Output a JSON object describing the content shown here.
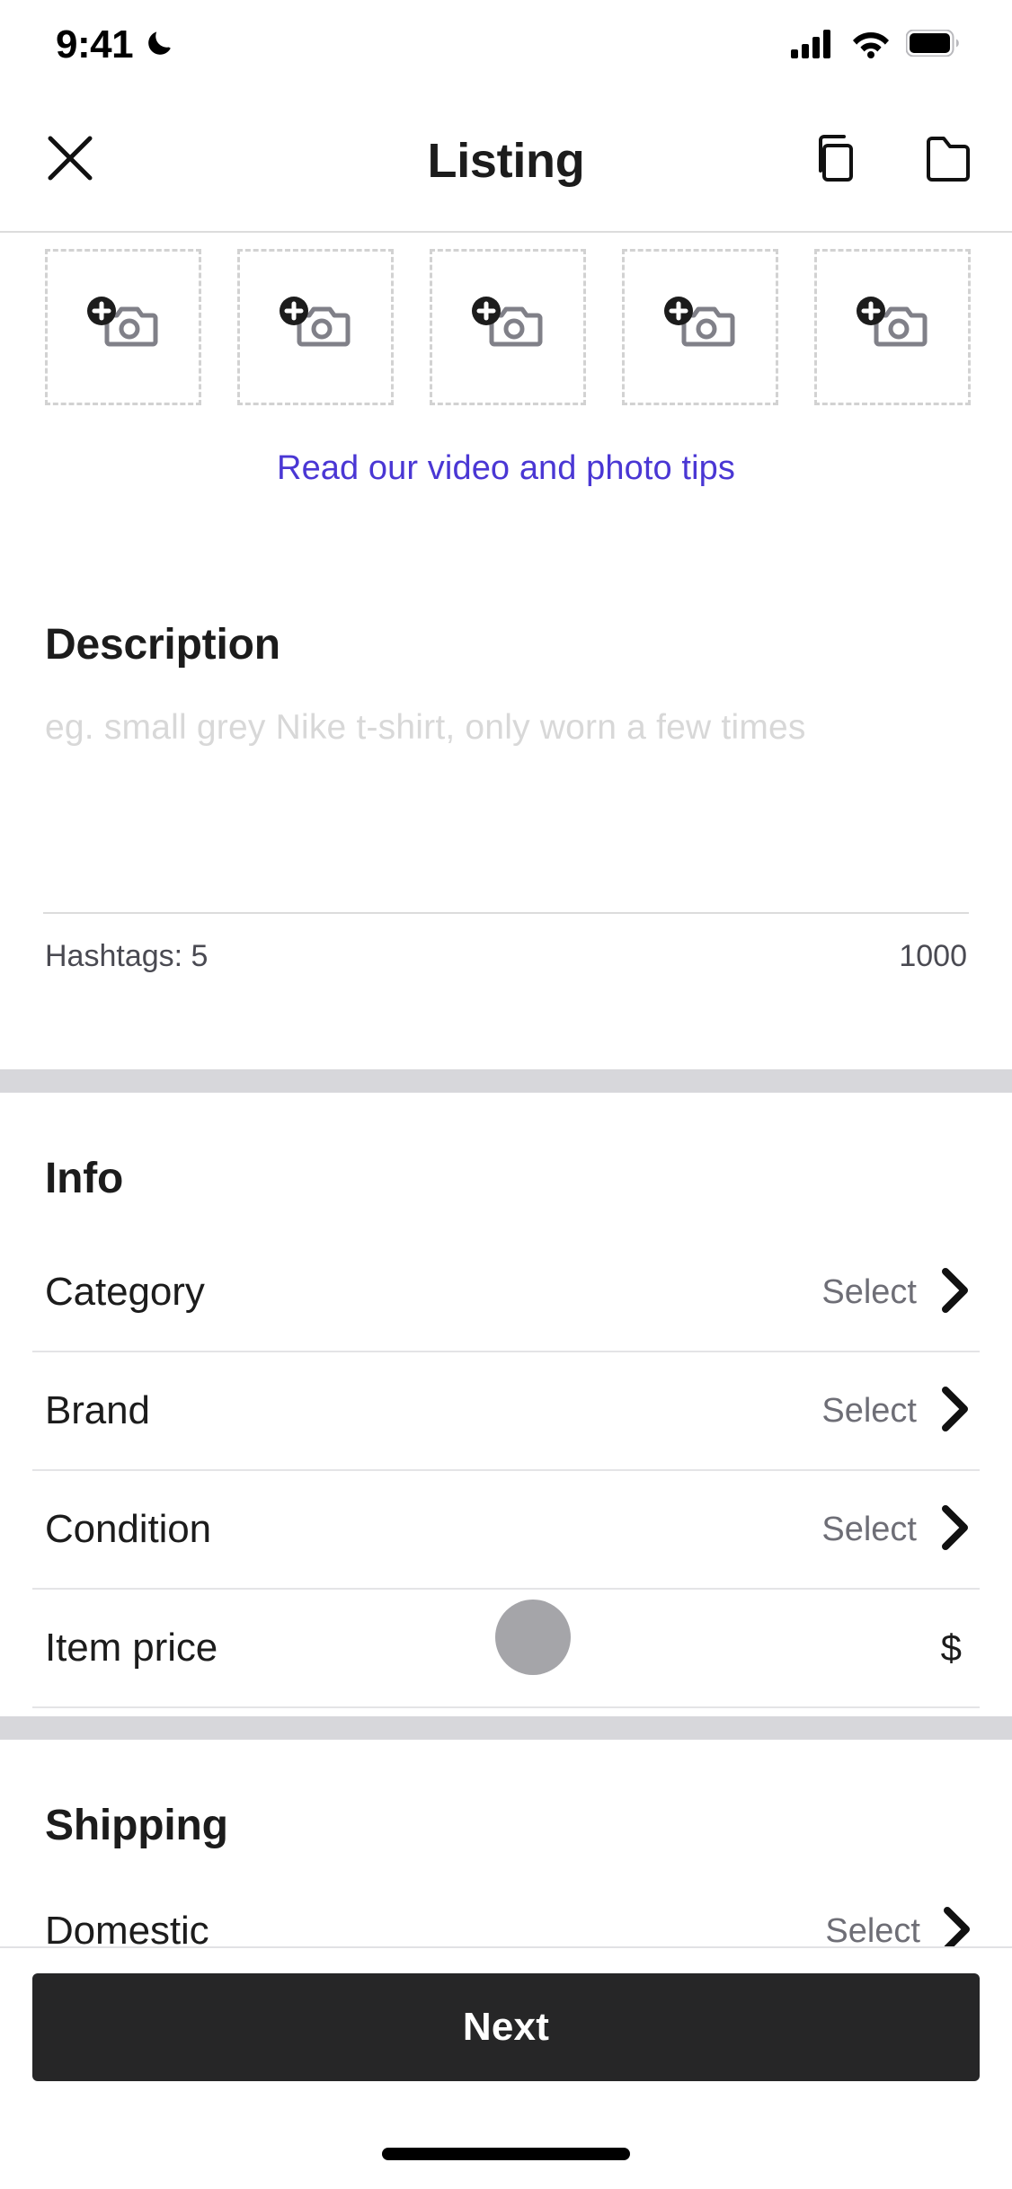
{
  "status_bar": {
    "time": "9:41",
    "dnd_icon": "crescent-moon-icon",
    "cellular_icon": "signal-bars-icon",
    "wifi_icon": "wifi-icon",
    "battery_icon": "battery-full-icon"
  },
  "header": {
    "close_icon": "close-x-icon",
    "title": "Listing",
    "copy_icon": "duplicate-copy-icon",
    "folder_icon": "folder-icon"
  },
  "photos": {
    "tile_icon": "add-photo-camera-icon",
    "tiles": [
      {
        "label": "Add photo 1"
      },
      {
        "label": "Add photo 2"
      },
      {
        "label": "Add photo 3"
      },
      {
        "label": "Add photo 4"
      },
      {
        "label": "Add photo 5"
      }
    ],
    "tips_link": "Read our video and photo tips",
    "tips_link_color": "#4a37d4"
  },
  "description": {
    "heading": "Description",
    "placeholder": "eg. small grey Nike t-shirt, only worn a few times",
    "value": "",
    "hashtags_label": "Hashtags: 5",
    "char_limit": "1000"
  },
  "info": {
    "heading": "Info",
    "rows": [
      {
        "label": "Category",
        "value": "Select",
        "accessory": "chevron-right-icon"
      },
      {
        "label": "Brand",
        "value": "Select",
        "accessory": "chevron-right-icon"
      },
      {
        "label": "Condition",
        "value": "Select",
        "accessory": "chevron-right-icon"
      },
      {
        "label": "Item price",
        "value": "$",
        "accessory": "currency-symbol"
      }
    ]
  },
  "shipping": {
    "heading": "Shipping",
    "rows": [
      {
        "label": "Domestic",
        "value": "Select",
        "accessory": "chevron-right-icon"
      }
    ]
  },
  "footer": {
    "next_label": "Next",
    "next_bg": "#262627",
    "home_indicator": "home-indicator-bar"
  }
}
